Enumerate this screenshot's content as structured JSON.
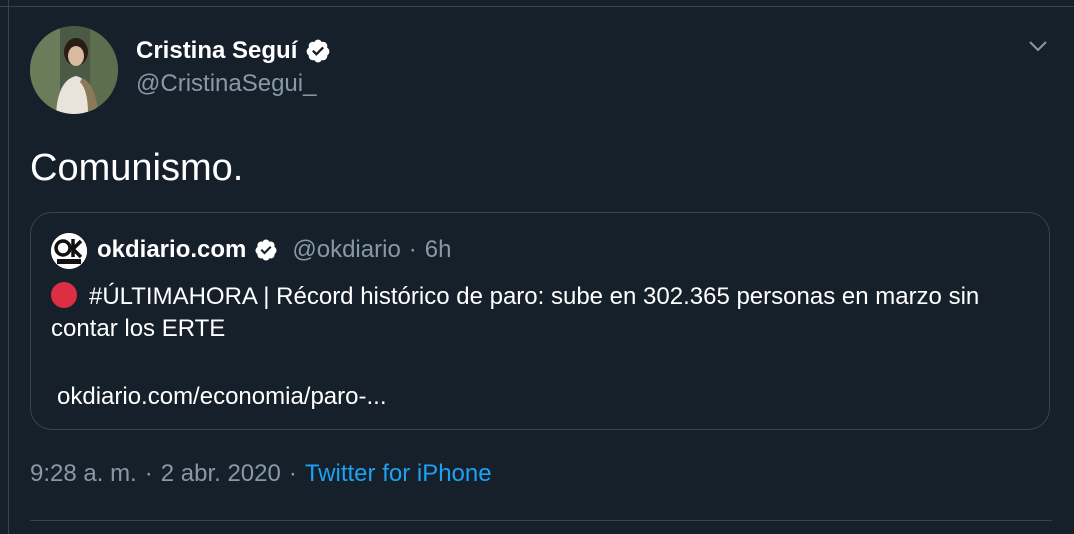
{
  "author": {
    "display_name": "Cristina Seguí",
    "handle": "@CristinaSegui_"
  },
  "tweet": {
    "text": "Comunismo."
  },
  "quoted_tweet": {
    "display_name": "okdiario.com",
    "handle": "@okdiario",
    "separator": "·",
    "age": "6h",
    "text": "#ÚLTIMAHORA | Récord histórico de paro: sube en 302.365 personas en marzo sin contar los ERTE",
    "link": "okdiario.com/economia/paro-...",
    "logo_text": "ok"
  },
  "meta": {
    "time": "9:28 a. m.",
    "dot1": "·",
    "date": "2 abr. 2020",
    "dot2": "·",
    "source": "Twitter for iPhone"
  },
  "colors": {
    "background": "#15202b",
    "border": "#38444d",
    "secondary_text": "#8899a6",
    "link": "#1da1f2",
    "red_dot": "#dd2e44"
  }
}
